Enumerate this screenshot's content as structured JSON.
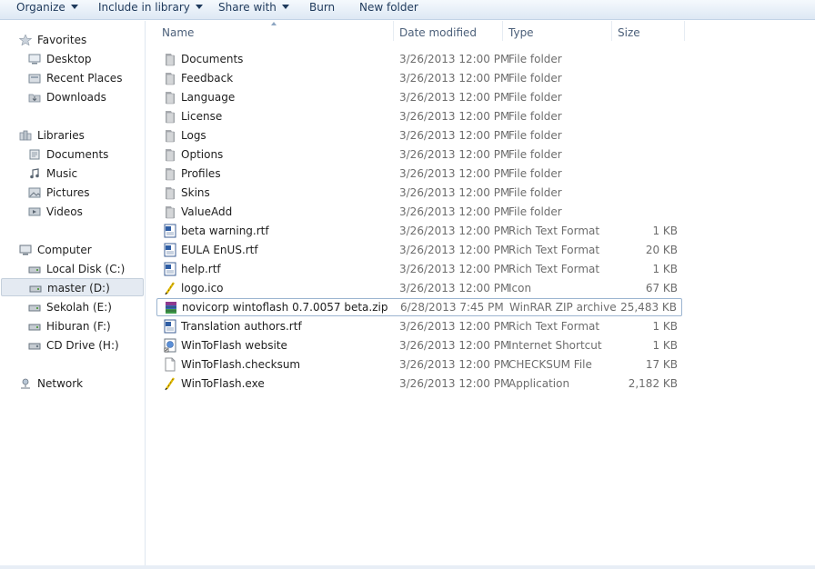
{
  "toolbar": {
    "organize": "Organize",
    "include_in_library": "Include in library",
    "share_with": "Share with",
    "burn": "Burn",
    "new_folder": "New folder"
  },
  "nav": {
    "favorites": {
      "label": "Favorites",
      "items": [
        {
          "label": "Desktop",
          "icon": "desktop-icon"
        },
        {
          "label": "Recent Places",
          "icon": "recent-places-icon"
        },
        {
          "label": "Downloads",
          "icon": "downloads-icon"
        }
      ]
    },
    "libraries": {
      "label": "Libraries",
      "items": [
        {
          "label": "Documents",
          "icon": "documents-library-icon"
        },
        {
          "label": "Music",
          "icon": "music-library-icon"
        },
        {
          "label": "Pictures",
          "icon": "pictures-library-icon"
        },
        {
          "label": "Videos",
          "icon": "videos-library-icon"
        }
      ]
    },
    "computer": {
      "label": "Computer",
      "items": [
        {
          "label": "Local Disk (C:)",
          "icon": "drive-icon"
        },
        {
          "label": "master (D:)",
          "icon": "drive-icon",
          "selected": true
        },
        {
          "label": "Sekolah (E:)",
          "icon": "drive-icon"
        },
        {
          "label": "Hiburan (F:)",
          "icon": "drive-icon"
        },
        {
          "label": "CD Drive (H:)",
          "icon": "cd-drive-icon"
        }
      ]
    },
    "network": {
      "label": "Network"
    }
  },
  "columns": {
    "name": "Name",
    "date": "Date modified",
    "type": "Type",
    "size": "Size"
  },
  "files": [
    {
      "name": "Documents",
      "date": "3/26/2013 12:00 PM",
      "type": "File folder",
      "size": "",
      "icon": "folder"
    },
    {
      "name": "Feedback",
      "date": "3/26/2013 12:00 PM",
      "type": "File folder",
      "size": "",
      "icon": "folder"
    },
    {
      "name": "Language",
      "date": "3/26/2013 12:00 PM",
      "type": "File folder",
      "size": "",
      "icon": "folder"
    },
    {
      "name": "License",
      "date": "3/26/2013 12:00 PM",
      "type": "File folder",
      "size": "",
      "icon": "folder"
    },
    {
      "name": "Logs",
      "date": "3/26/2013 12:00 PM",
      "type": "File folder",
      "size": "",
      "icon": "folder"
    },
    {
      "name": "Options",
      "date": "3/26/2013 12:00 PM",
      "type": "File folder",
      "size": "",
      "icon": "folder"
    },
    {
      "name": "Profiles",
      "date": "3/26/2013 12:00 PM",
      "type": "File folder",
      "size": "",
      "icon": "folder"
    },
    {
      "name": "Skins",
      "date": "3/26/2013 12:00 PM",
      "type": "File folder",
      "size": "",
      "icon": "folder"
    },
    {
      "name": "ValueAdd",
      "date": "3/26/2013 12:00 PM",
      "type": "File folder",
      "size": "",
      "icon": "folder"
    },
    {
      "name": "beta warning.rtf",
      "date": "3/26/2013 12:00 PM",
      "type": "Rich Text Format",
      "size": "1 KB",
      "icon": "rtf"
    },
    {
      "name": "EULA EnUS.rtf",
      "date": "3/26/2013 12:00 PM",
      "type": "Rich Text Format",
      "size": "20 KB",
      "icon": "rtf"
    },
    {
      "name": "help.rtf",
      "date": "3/26/2013 12:00 PM",
      "type": "Rich Text Format",
      "size": "1 KB",
      "icon": "rtf"
    },
    {
      "name": "logo.ico",
      "date": "3/26/2013 12:00 PM",
      "type": "Icon",
      "size": "67 KB",
      "icon": "pencil"
    },
    {
      "name": "novicorp wintoflash 0.7.0057 beta.zip",
      "date": "6/28/2013 7:45 PM",
      "type": "WinRAR ZIP archive",
      "size": "25,483 KB",
      "icon": "zip",
      "focused": true
    },
    {
      "name": "Translation authors.rtf",
      "date": "3/26/2013 12:00 PM",
      "type": "Rich Text Format",
      "size": "1 KB",
      "icon": "rtf"
    },
    {
      "name": "WinToFlash website",
      "date": "3/26/2013 12:00 PM",
      "type": "Internet Shortcut",
      "size": "1 KB",
      "icon": "shortcut"
    },
    {
      "name": "WinToFlash.checksum",
      "date": "3/26/2013 12:00 PM",
      "type": "CHECKSUM File",
      "size": "17 KB",
      "icon": "blank"
    },
    {
      "name": "WinToFlash.exe",
      "date": "3/26/2013 12:00 PM",
      "type": "Application",
      "size": "2,182 KB",
      "icon": "pencil"
    }
  ]
}
